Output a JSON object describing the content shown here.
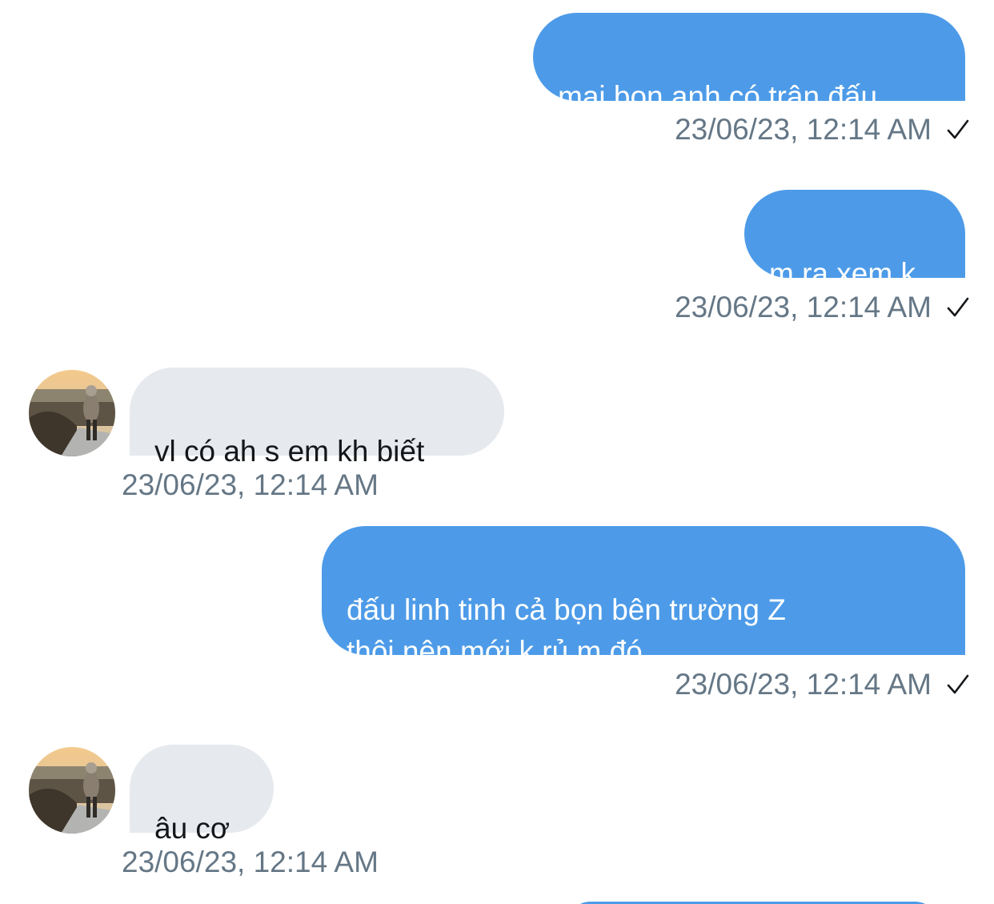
{
  "messages": [
    {
      "direction": "outgoing",
      "text": "mai bọn anh có trận đấu",
      "time": "23/06/23, 12:14 AM",
      "status_icon": "check-icon"
    },
    {
      "direction": "outgoing",
      "text": "m ra xem k",
      "time": "23/06/23, 12:14 AM",
      "status_icon": "check-icon"
    },
    {
      "direction": "incoming",
      "text": "vl có ah s em kh biết",
      "time": "23/06/23, 12:14 AM",
      "avatar": "avatar-photo"
    },
    {
      "direction": "outgoing",
      "text": "đấu linh tinh cả bọn bên trường Z\nthôi nên mới k rủ m đó",
      "time": "23/06/23, 12:14 AM",
      "status_icon": "check-icon"
    },
    {
      "direction": "incoming",
      "text": "âu cơ",
      "time": "23/06/23, 12:14 AM",
      "avatar": "avatar-photo"
    }
  ],
  "colors": {
    "outgoing_bubble": "#4d9be8",
    "incoming_bubble": "#e6e9ee",
    "timestamp": "#657786",
    "incoming_text": "#14171a"
  }
}
